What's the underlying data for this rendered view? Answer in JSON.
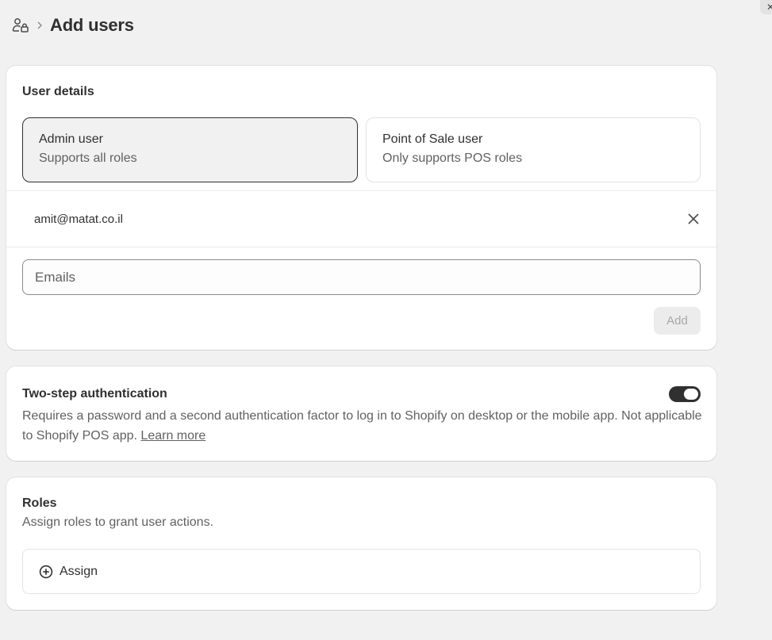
{
  "header": {
    "title": "Add users",
    "users_icon": "users-icon",
    "separator_icon": "chevron-right-icon"
  },
  "corner": {
    "close_glyph": "✕"
  },
  "user_details": {
    "title": "User details",
    "options": [
      {
        "title": "Admin user",
        "subtitle": "Supports all roles",
        "selected": true
      },
      {
        "title": "Point of Sale user",
        "subtitle": "Only supports POS roles",
        "selected": false
      }
    ],
    "added_emails": [
      "amit@matat.co.il"
    ],
    "emails_input": {
      "placeholder": "Emails",
      "value": ""
    },
    "add_label": "Add"
  },
  "two_step": {
    "title": "Two-step authentication",
    "enabled": true,
    "description": "Requires a password and a second authentication factor to log in to Shopify on desktop or the mobile app. Not applicable to Shopify POS app.",
    "learn_more": "Learn more"
  },
  "roles": {
    "title": "Roles",
    "subtitle": "Assign roles to grant user actions.",
    "assign_label": "Assign"
  },
  "colors": {
    "background": "#f1f1f1",
    "card": "#ffffff",
    "text": "#303030",
    "muted": "#616161",
    "toggle_on": "#303030"
  }
}
